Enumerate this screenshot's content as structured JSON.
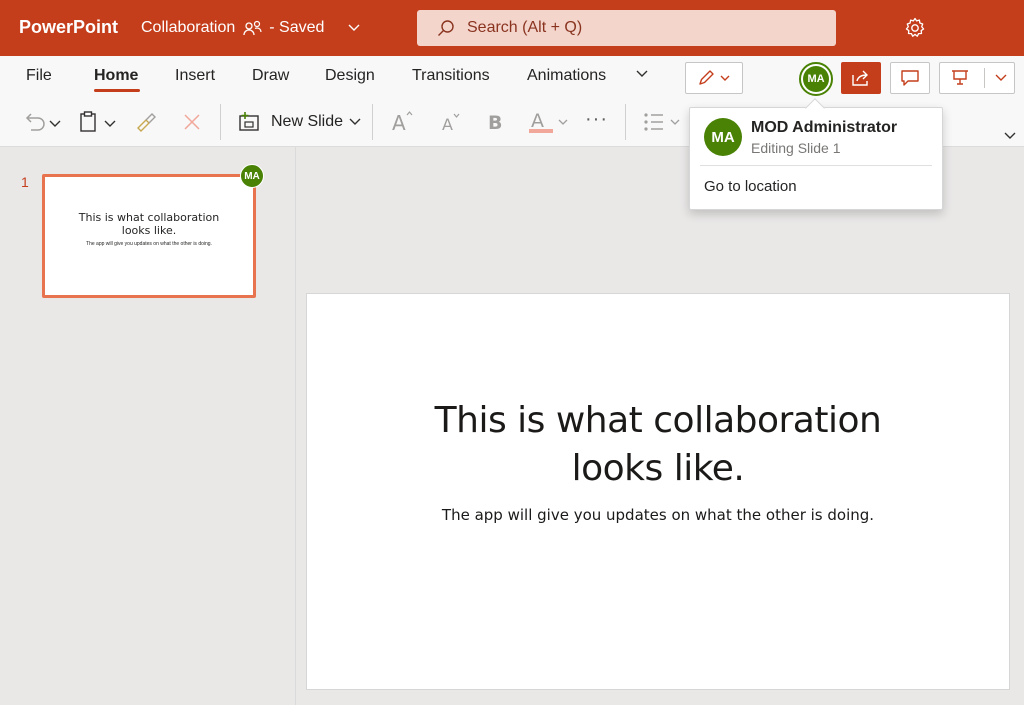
{
  "titlebar": {
    "app_name": "PowerPoint",
    "doc_name": "Collaboration",
    "save_state": "- Saved",
    "search_placeholder": "Search (Alt + Q)"
  },
  "ribbon": {
    "tabs": [
      "File",
      "Home",
      "Insert",
      "Draw",
      "Design",
      "Transitions",
      "Animations"
    ],
    "active_tab": "Home",
    "new_slide_label": "New Slide",
    "more_label": "···"
  },
  "presence": {
    "initials": "MA",
    "name": "MOD Administrator",
    "status": "Editing Slide 1",
    "action": "Go to location"
  },
  "thumbnail": {
    "number": "1",
    "title": "This is what collaboration looks like.",
    "subtitle": "The app will give you updates on what the other is doing."
  },
  "slide": {
    "title_line1": "This is what collaboration",
    "title_line2": "looks like.",
    "subtitle": "The app will give you updates on what the other is doing."
  },
  "colors": {
    "brand": "#c43e1c",
    "presence": "#498205"
  }
}
